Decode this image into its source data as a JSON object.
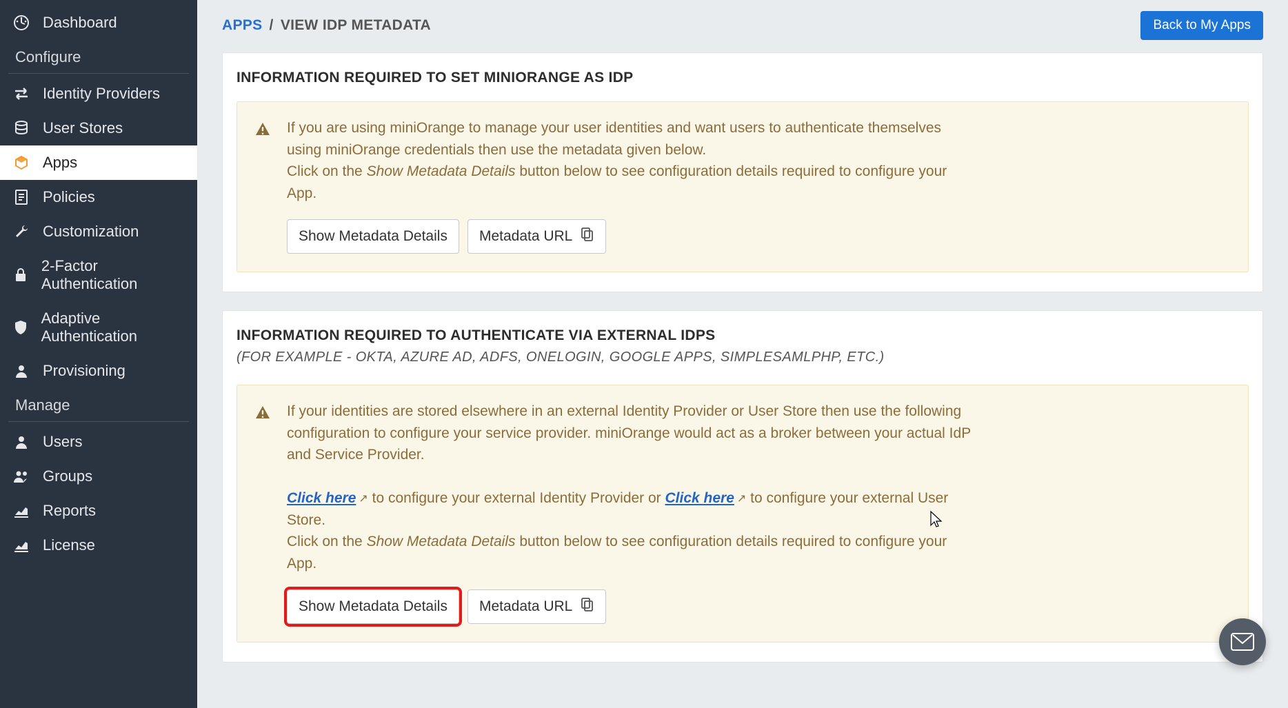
{
  "sidebar": {
    "items": [
      {
        "label": "Dashboard"
      },
      {
        "label": "Identity Providers"
      },
      {
        "label": "User Stores"
      },
      {
        "label": "Apps"
      },
      {
        "label": "Policies"
      },
      {
        "label": "Customization"
      },
      {
        "label": "2-Factor Authentication"
      },
      {
        "label": "Adaptive Authentication"
      },
      {
        "label": "Provisioning"
      },
      {
        "label": "Users"
      },
      {
        "label": "Groups"
      },
      {
        "label": "Reports"
      },
      {
        "label": "License"
      }
    ],
    "section_configure": "Configure",
    "section_manage": "Manage"
  },
  "header": {
    "bc_link": "APPS",
    "bc_sep": "/",
    "bc_current": "VIEW IDP METADATA",
    "back_btn": "Back to My Apps"
  },
  "card1": {
    "title": "INFORMATION REQUIRED TO SET MINIORANGE AS IDP",
    "p1": "If you are using miniOrange to manage your user identities and want users to authenticate themselves using miniOrange credentials then use the metadata given below.",
    "p2a": "Click on the ",
    "p2em": "Show Metadata Details",
    "p2b": " button below to see configuration details required to configure your App.",
    "btn_show": "Show Metadata Details",
    "btn_url": "Metadata URL"
  },
  "card2": {
    "title": "INFORMATION REQUIRED TO AUTHENTICATE VIA EXTERNAL IDPS",
    "subtitle": "(FOR EXAMPLE - OKTA, AZURE AD, ADFS, ONELOGIN, GOOGLE APPS, SIMPLESAMLPHP, ETC.)",
    "p1": "If your identities are stored elsewhere in an external Identity Provider or User Store then use the following configuration to configure your service provider. miniOrange would act as a broker between your actual IdP and Service Provider.",
    "link1": "Click here",
    "p2a": " to configure your external Identity Provider or ",
    "link2": "Click here",
    "p2b": " to configure your external User Store.",
    "p3a": "Click on the ",
    "p3em": "Show Metadata Details",
    "p3b": " button below to see configuration details required to configure your App.",
    "btn_show": "Show Metadata Details",
    "btn_url": "Metadata URL"
  }
}
